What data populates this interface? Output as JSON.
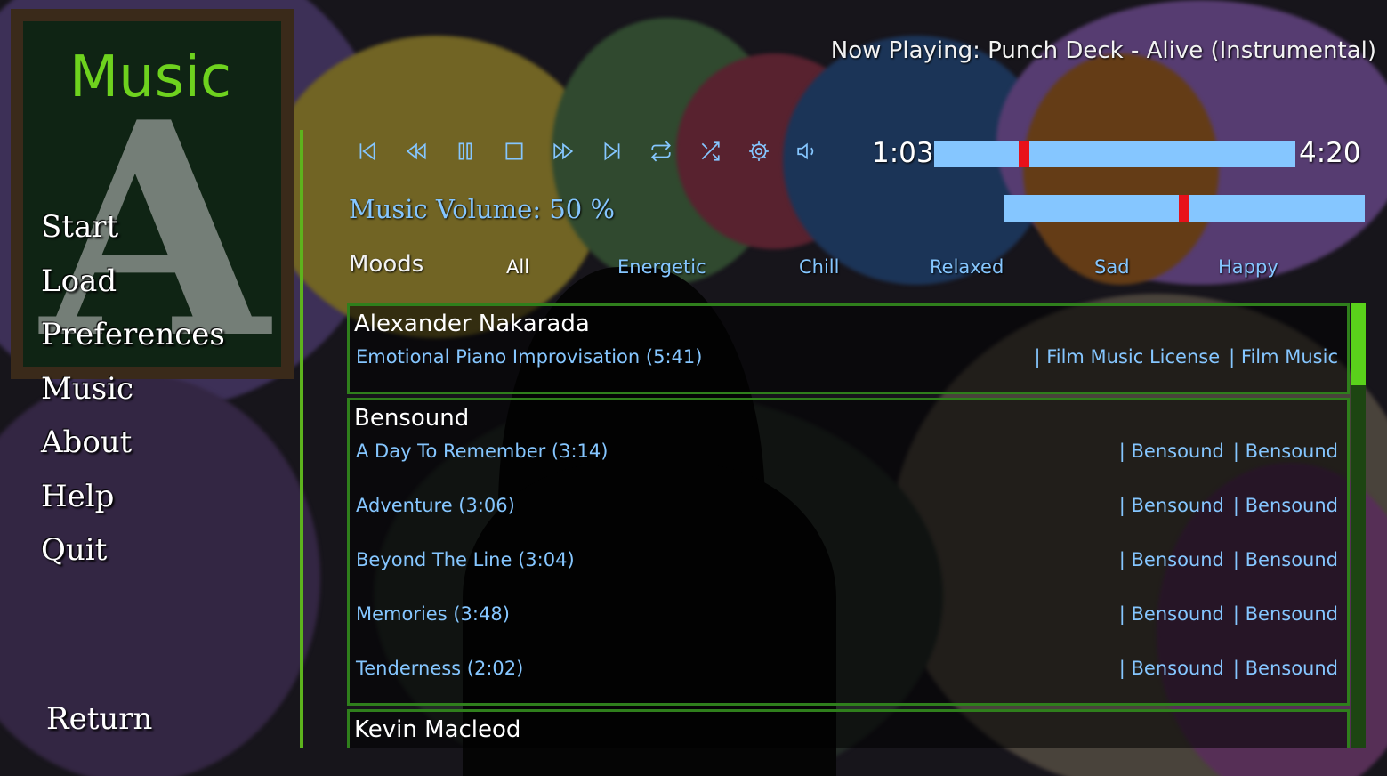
{
  "menu": {
    "title": "Music",
    "items": [
      {
        "label": "Start"
      },
      {
        "label": "Load"
      },
      {
        "label": "Preferences"
      },
      {
        "label": "Music"
      },
      {
        "label": "About"
      },
      {
        "label": "Help"
      },
      {
        "label": "Quit"
      }
    ],
    "return_label": "Return"
  },
  "player": {
    "now_playing": "Now Playing: Punch Deck - Alive (Instrumental)",
    "current_time": "1:03",
    "total_time": "4:20",
    "progress_fraction": 0.24,
    "controls": [
      "skip-back-icon",
      "rewind-icon",
      "pause-icon",
      "stop-icon",
      "fast-forward-icon",
      "skip-forward-icon",
      "repeat-icon",
      "shuffle-icon",
      "gear-icon",
      "volume-icon"
    ]
  },
  "volume": {
    "label": "Music Volume: 50 %",
    "fraction": 0.5
  },
  "moods": {
    "label": "Moods",
    "items": [
      {
        "label": "All",
        "active": true
      },
      {
        "label": "Energetic"
      },
      {
        "label": "Chill"
      },
      {
        "label": "Relaxed"
      },
      {
        "label": "Sad"
      },
      {
        "label": "Happy"
      }
    ]
  },
  "library": [
    {
      "artist": "Alexander Nakarada",
      "tracks": [
        {
          "title": "Emotional Piano Improvisation (5:41)",
          "credit1": "| Film Music License",
          "credit2": "| Film Music"
        }
      ]
    },
    {
      "artist": "Bensound",
      "tracks": [
        {
          "title": "A Day To Remember (3:14)",
          "credit1": "| Bensound",
          "credit2": "| Bensound"
        },
        {
          "title": "Adventure (3:06)",
          "credit1": "| Bensound",
          "credit2": "| Bensound"
        },
        {
          "title": "Beyond The Line (3:04)",
          "credit1": "| Bensound",
          "credit2": "| Bensound"
        },
        {
          "title": "Memories (3:48)",
          "credit1": "| Bensound",
          "credit2": "| Bensound"
        },
        {
          "title": "Tenderness (2:02)",
          "credit1": "| Bensound",
          "credit2": "| Bensound"
        }
      ]
    },
    {
      "artist": "Kevin Macleod",
      "tracks": []
    }
  ],
  "colors": {
    "accent_green": "#5db31d",
    "link_blue": "#85c6ff",
    "bar_thumb_red": "#e8111a"
  }
}
